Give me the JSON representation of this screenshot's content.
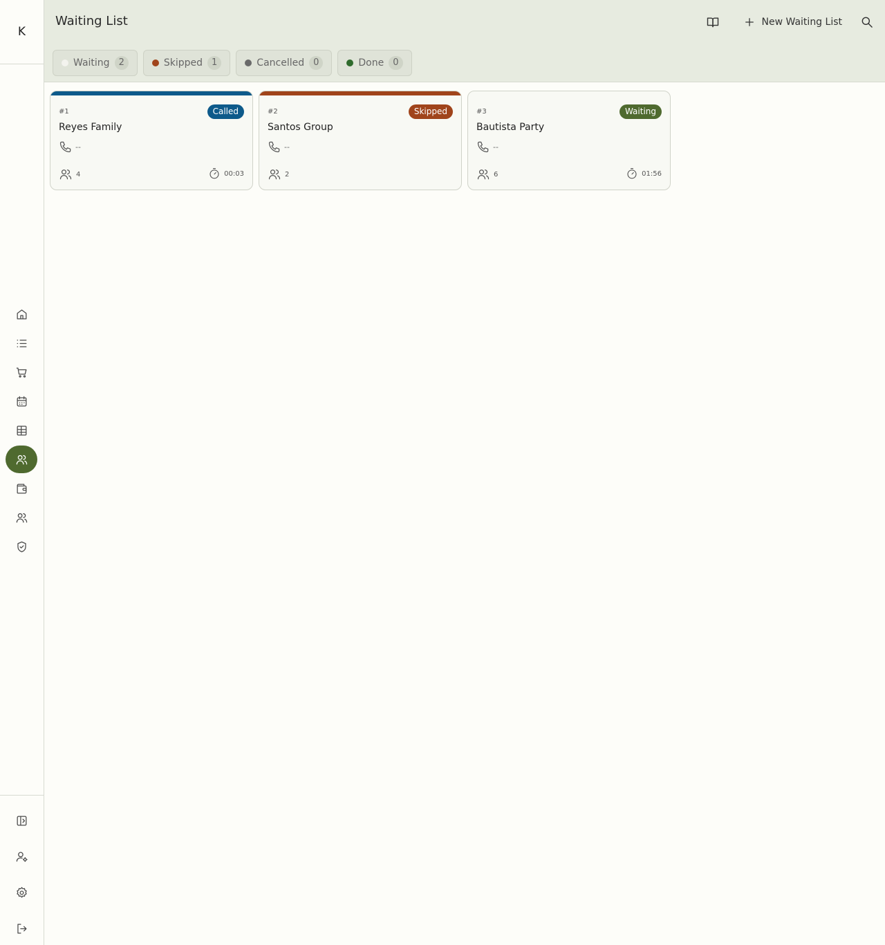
{
  "app": {
    "logo_letter": "K"
  },
  "sidebar": {
    "items": [
      {
        "icon": "home-icon",
        "active": false
      },
      {
        "icon": "list-icon",
        "active": false
      },
      {
        "icon": "cart-icon",
        "active": false
      },
      {
        "icon": "calendar-icon",
        "active": false
      },
      {
        "icon": "table-icon",
        "active": false
      },
      {
        "icon": "users-icon",
        "active": true
      },
      {
        "icon": "wallet-icon",
        "active": false
      },
      {
        "icon": "people-icon",
        "active": false
      },
      {
        "icon": "shield-icon",
        "active": false
      }
    ],
    "bottom": [
      {
        "icon": "sidebar-toggle-icon"
      },
      {
        "icon": "user-settings-icon"
      },
      {
        "icon": "gear-icon"
      },
      {
        "icon": "logout-icon"
      }
    ]
  },
  "header": {
    "title": "Waiting List",
    "new_label": "New Waiting List"
  },
  "filters": [
    {
      "label": "Waiting",
      "count": "2",
      "color": "#f3f3ee"
    },
    {
      "label": "Skipped",
      "count": "1",
      "color": "#a0441b"
    },
    {
      "label": "Cancelled",
      "count": "0",
      "color": "#6a6a6a"
    },
    {
      "label": "Done",
      "count": "0",
      "color": "#2f6b2c"
    }
  ],
  "cards": [
    {
      "number": "#1",
      "name": "Reyes Family",
      "status": "Called",
      "status_color": "#0d5a8a",
      "phone": "--",
      "party_size": "4",
      "timer": "00:03"
    },
    {
      "number": "#2",
      "name": "Santos Group",
      "status": "Skipped",
      "status_color": "#a0441b",
      "phone": "--",
      "party_size": "2",
      "timer": ""
    },
    {
      "number": "#3",
      "name": "Bautista Party",
      "status": "Waiting",
      "status_color": "#4f6a2f",
      "phone": "--",
      "party_size": "6",
      "timer": "01:56"
    }
  ]
}
